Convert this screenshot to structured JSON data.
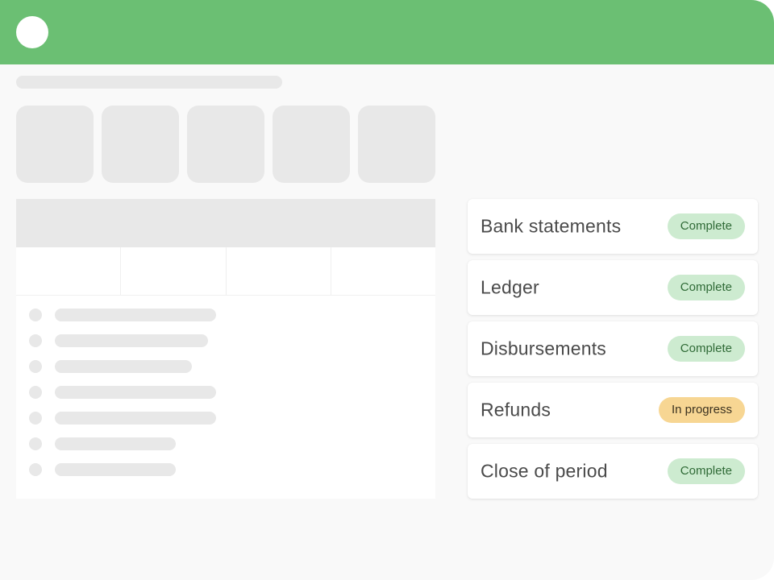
{
  "header": {
    "avatar_icon": "user-avatar-placeholder",
    "color": "#6bbf73"
  },
  "statuses": [
    {
      "label": "Bank statements",
      "status": "Complete",
      "status_color": "#cdebd0"
    },
    {
      "label": "Ledger",
      "status": "Complete",
      "status_color": "#cdebd0"
    },
    {
      "label": "Disbursements",
      "status": "Complete",
      "status_color": "#cdebd0"
    },
    {
      "label": "Refunds",
      "status": "In progress",
      "status_color": "#f7d693"
    },
    {
      "label": "Close of period",
      "status": "Complete",
      "status_color": "#cdebd0"
    }
  ]
}
